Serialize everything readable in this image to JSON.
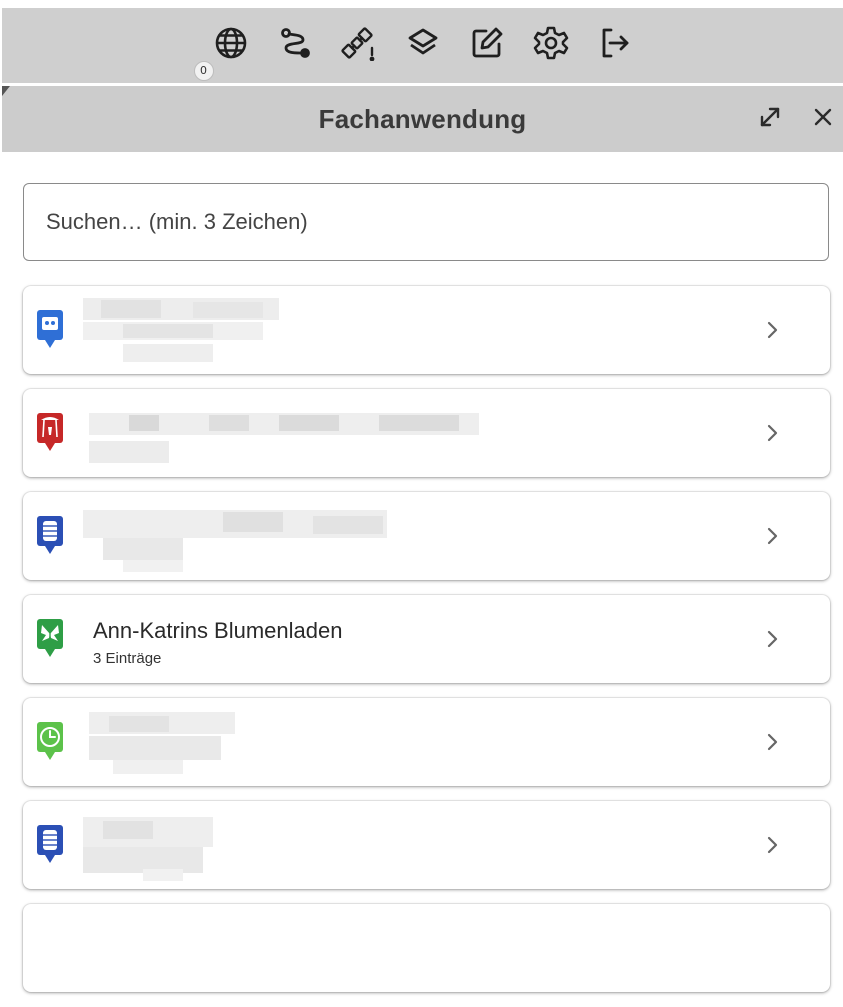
{
  "toolbar": {
    "badge_count": "0",
    "tools": [
      {
        "icon": "globe-icon"
      },
      {
        "icon": "route-icon"
      },
      {
        "icon": "satellite-warning-icon"
      },
      {
        "icon": "layers-icon"
      },
      {
        "icon": "edit-icon"
      },
      {
        "icon": "settings-icon"
      },
      {
        "icon": "logout-icon"
      }
    ]
  },
  "panel": {
    "title": "Fachanwendung",
    "expand_icon": "expand-icon",
    "close_icon": "close-icon"
  },
  "search": {
    "placeholder": "Suchen… (min. 3 Zeichen)",
    "value": ""
  },
  "list": [
    {
      "icon": "cinema-pin-icon",
      "color": "#2f6fd6",
      "title": "",
      "subtitle": "",
      "redacted": true
    },
    {
      "icon": "playground-pin-icon",
      "color": "#c62828",
      "title": "",
      "subtitle": "",
      "redacted": true
    },
    {
      "icon": "database-pin-icon",
      "color": "#2b4fb5",
      "title": "",
      "subtitle": "",
      "redacted": true
    },
    {
      "icon": "butterfly-pin-icon",
      "color": "#2e9e46",
      "title": "Ann-Katrins Blumenladen",
      "subtitle": "3 Einträge",
      "redacted": false
    },
    {
      "icon": "clock-pin-icon",
      "color": "#5cc24a",
      "title": "",
      "subtitle": "",
      "redacted": true
    },
    {
      "icon": "database-pin-icon",
      "color": "#2b4fb5",
      "title": "",
      "subtitle": "",
      "redacted": true
    }
  ]
}
